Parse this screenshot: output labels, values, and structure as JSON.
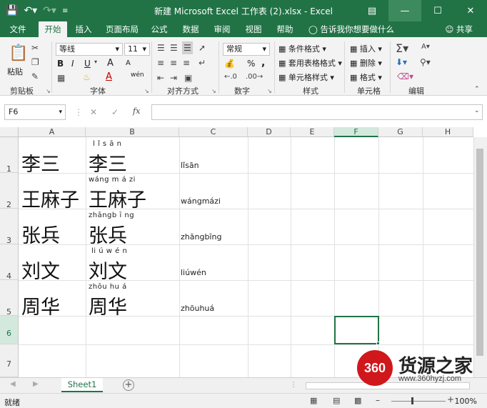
{
  "window": {
    "title": "新建 Microsoft Excel 工作表 (2).xlsx  -  Excel",
    "qat_icons": [
      "save-icon",
      "undo-icon",
      "redo-icon",
      "customize-icon"
    ],
    "controls": [
      "ribbon-display-icon",
      "minimize-icon",
      "restore-icon",
      "close-icon"
    ]
  },
  "tabs": [
    "文件",
    "开始",
    "插入",
    "页面布局",
    "公式",
    "数据",
    "审阅",
    "视图",
    "帮助"
  ],
  "active_tab": "开始",
  "tell_me": "告诉我你想要做什么",
  "share": "共享",
  "ribbon": {
    "clipboard": {
      "label": "剪贴板",
      "paste": "粘贴"
    },
    "font": {
      "label": "字体",
      "name": "等线",
      "size": "11",
      "bold": "B",
      "italic": "I",
      "underline": "U",
      "grow": "A",
      "shrink": "A",
      "font_color_glyph": "A",
      "wen": "wén"
    },
    "alignment": {
      "label": "对齐方式"
    },
    "number": {
      "label": "数字",
      "format": "常规",
      "percent": "%",
      "comma": ","
    },
    "styles": {
      "label": "样式",
      "conditional": "条件格式",
      "table": "套用表格格式",
      "cell_styles": "单元格样式"
    },
    "cells": {
      "label": "单元格",
      "insert": "插入",
      "delete": "删除",
      "format": "格式"
    },
    "editing": {
      "label": "编辑"
    }
  },
  "formula_bar": {
    "name_box": "F6",
    "formula": "",
    "fx": "fx"
  },
  "columns": [
    "A",
    "B",
    "C",
    "D",
    "E",
    "F",
    "G",
    "H"
  ],
  "rows": [
    "1",
    "2",
    "3",
    "4",
    "5",
    "6",
    "7"
  ],
  "selected_cell": {
    "col": "F",
    "row": "6"
  },
  "cells": [
    {
      "a": "李三",
      "ruby": "l  ǐ  s ā n",
      "b": "李三",
      "c": "lǐsān"
    },
    {
      "a": "王麻子",
      "ruby": "wáng m á   zi",
      "b": "王麻子",
      "c": "wángmázi"
    },
    {
      "a": "张兵",
      "ruby": "zhāngb ī ng",
      "b": "张兵",
      "c": "zhāngbīng"
    },
    {
      "a": "刘文",
      "ruby": "li  ú  w é n",
      "b": "刘文",
      "c": "liúwén"
    },
    {
      "a": "周华",
      "ruby": "zhōu hu  á",
      "b": "周华",
      "c": "zhōuhuá"
    }
  ],
  "sheet_tabs": [
    "Sheet1"
  ],
  "status": {
    "ready": "就绪",
    "zoom": "100%"
  },
  "watermark": {
    "logo": "360",
    "title": "货源之家",
    "url": "www.360hyzj.com"
  }
}
